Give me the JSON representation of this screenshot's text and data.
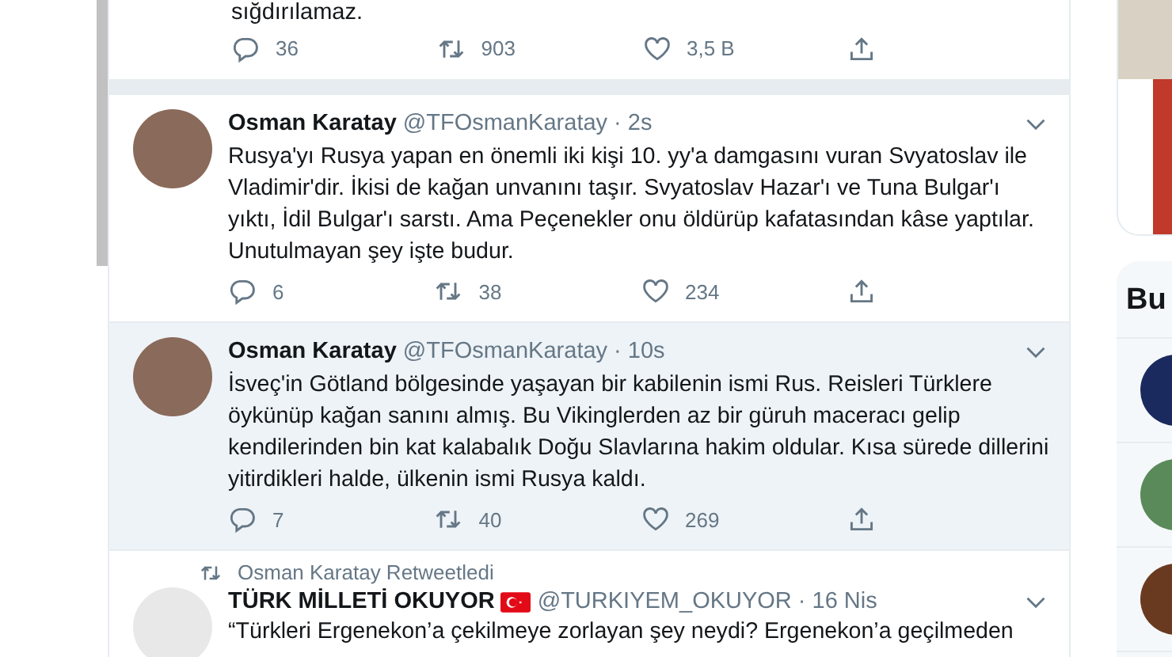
{
  "timeline": [
    {
      "kind": "partial",
      "text": "sığdırılamaz.",
      "replies": "36",
      "retweets": "903",
      "likes": "3,5 B"
    },
    {
      "kind": "tweet",
      "name": "Osman Karatay",
      "handle": "@TFOsmanKaratay",
      "time": "· 2s",
      "text": "Rusya'yı Rusya yapan en önemli iki kişi 10. yy'a damgasını vuran Svyatoslav ile Vladimir'dir. İkisi de kağan unvanını taşır. Svyatoslav Hazar'ı ve Tuna Bulgar'ı yıktı, İdil Bulgar'ı sarstı. Ama Peçenekler onu öldürüp kafatasından kâse yaptılar. Unutulmayan şey işte budur.",
      "replies": "6",
      "retweets": "38",
      "likes": "234",
      "highlighted": false
    },
    {
      "kind": "tweet",
      "name": "Osman Karatay",
      "handle": "@TFOsmanKaratay",
      "time": "· 10s",
      "text": "İsveç'in Götland bölgesinde yaşayan bir kabilenin ismi Rus. Reisleri Türklere öykünüp kağan sanını almış. Bu Vikinglerden az bir güruh maceracı gelip kendilerinden bin kat kalabalık Doğu Slavlarına hakim oldular. Kısa sürede dillerini yitirdikleri halde, ülkenin ismi Rusya kaldı.",
      "replies": "7",
      "retweets": "40",
      "likes": "269",
      "highlighted": true
    },
    {
      "kind": "retweet",
      "retweeted_by": "Osman Karatay Retweetledi",
      "name": "TÜRK MİLLETİ OKUYOR",
      "handle": "@TURKIYEM_OKUYOR",
      "time": "· 16 Nis",
      "text": "“Türkleri Ergenekon’a çekilmeye zorlayan şey neydi? Ergenekon’a geçilmeden",
      "highlighted": false
    }
  ],
  "sidebar": {
    "heading": "Bu"
  }
}
